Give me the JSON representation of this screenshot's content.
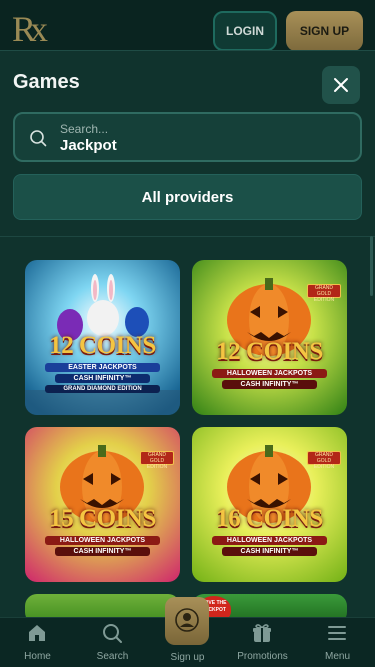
{
  "header": {
    "logo_text": "Rx",
    "login_label": "LOGIN",
    "signup_label": "SIGN UP"
  },
  "panel": {
    "title": "Games",
    "search": {
      "placeholder": "Search...",
      "value": "Jackpot"
    },
    "providers_label": "All providers"
  },
  "games": [
    {
      "coins": "12 COINS",
      "line1": "EASTER JACKPOTS",
      "line2": "CASH INFINITY™",
      "line3": "GRAND DIAMOND EDITION",
      "theme": "easter"
    },
    {
      "coins": "12 COINS",
      "line1": "HALLOWEEN JACKPOTS",
      "line2": "CASH INFINITY™",
      "badge": "GRAND GOLD EDITION",
      "theme": "halloween"
    },
    {
      "coins": "15 COINS",
      "line1": "HALLOWEEN JACKPOTS",
      "line2": "CASH INFINITY™",
      "badge": "GRAND GOLD EDITION",
      "theme": "halloween-pink"
    },
    {
      "coins": "16 COINS",
      "line1": "HALLOWEEN JACKPOTS",
      "line2": "CASH INFINITY™",
      "badge": "GRAND GOLD EDITION",
      "theme": "halloween-lime"
    }
  ],
  "partial_tiles": [
    {
      "badge": "LOVE THE JACKPOT"
    }
  ],
  "bottom_nav": {
    "items": [
      {
        "label": "Home",
        "icon": "home-icon"
      },
      {
        "label": "Search",
        "icon": "search-icon"
      },
      {
        "label": "Sign up",
        "icon": "user-icon"
      },
      {
        "label": "Promotions",
        "icon": "gift-icon"
      },
      {
        "label": "Menu",
        "icon": "menu-icon"
      }
    ]
  },
  "colors": {
    "background": "#0d2d28",
    "panel": "#10332d",
    "accent_gold": "#a89058",
    "button_teal": "#1b5048"
  }
}
